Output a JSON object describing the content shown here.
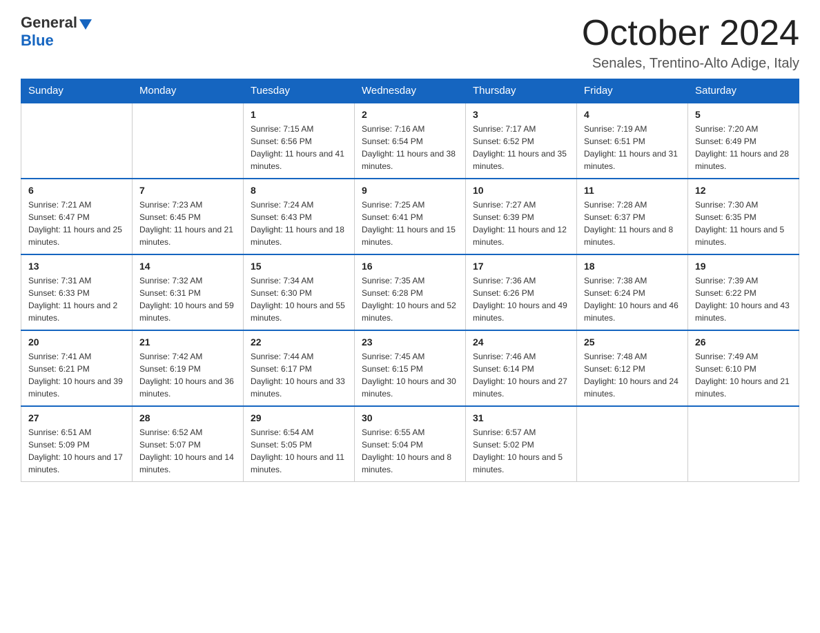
{
  "logo": {
    "general": "General",
    "blue": "Blue"
  },
  "header": {
    "month_year": "October 2024",
    "location": "Senales, Trentino-Alto Adige, Italy"
  },
  "weekdays": [
    "Sunday",
    "Monday",
    "Tuesday",
    "Wednesday",
    "Thursday",
    "Friday",
    "Saturday"
  ],
  "weeks": [
    [
      {
        "day": "",
        "sunrise": "",
        "sunset": "",
        "daylight": ""
      },
      {
        "day": "",
        "sunrise": "",
        "sunset": "",
        "daylight": ""
      },
      {
        "day": "1",
        "sunrise": "Sunrise: 7:15 AM",
        "sunset": "Sunset: 6:56 PM",
        "daylight": "Daylight: 11 hours and 41 minutes."
      },
      {
        "day": "2",
        "sunrise": "Sunrise: 7:16 AM",
        "sunset": "Sunset: 6:54 PM",
        "daylight": "Daylight: 11 hours and 38 minutes."
      },
      {
        "day": "3",
        "sunrise": "Sunrise: 7:17 AM",
        "sunset": "Sunset: 6:52 PM",
        "daylight": "Daylight: 11 hours and 35 minutes."
      },
      {
        "day": "4",
        "sunrise": "Sunrise: 7:19 AM",
        "sunset": "Sunset: 6:51 PM",
        "daylight": "Daylight: 11 hours and 31 minutes."
      },
      {
        "day": "5",
        "sunrise": "Sunrise: 7:20 AM",
        "sunset": "Sunset: 6:49 PM",
        "daylight": "Daylight: 11 hours and 28 minutes."
      }
    ],
    [
      {
        "day": "6",
        "sunrise": "Sunrise: 7:21 AM",
        "sunset": "Sunset: 6:47 PM",
        "daylight": "Daylight: 11 hours and 25 minutes."
      },
      {
        "day": "7",
        "sunrise": "Sunrise: 7:23 AM",
        "sunset": "Sunset: 6:45 PM",
        "daylight": "Daylight: 11 hours and 21 minutes."
      },
      {
        "day": "8",
        "sunrise": "Sunrise: 7:24 AM",
        "sunset": "Sunset: 6:43 PM",
        "daylight": "Daylight: 11 hours and 18 minutes."
      },
      {
        "day": "9",
        "sunrise": "Sunrise: 7:25 AM",
        "sunset": "Sunset: 6:41 PM",
        "daylight": "Daylight: 11 hours and 15 minutes."
      },
      {
        "day": "10",
        "sunrise": "Sunrise: 7:27 AM",
        "sunset": "Sunset: 6:39 PM",
        "daylight": "Daylight: 11 hours and 12 minutes."
      },
      {
        "day": "11",
        "sunrise": "Sunrise: 7:28 AM",
        "sunset": "Sunset: 6:37 PM",
        "daylight": "Daylight: 11 hours and 8 minutes."
      },
      {
        "day": "12",
        "sunrise": "Sunrise: 7:30 AM",
        "sunset": "Sunset: 6:35 PM",
        "daylight": "Daylight: 11 hours and 5 minutes."
      }
    ],
    [
      {
        "day": "13",
        "sunrise": "Sunrise: 7:31 AM",
        "sunset": "Sunset: 6:33 PM",
        "daylight": "Daylight: 11 hours and 2 minutes."
      },
      {
        "day": "14",
        "sunrise": "Sunrise: 7:32 AM",
        "sunset": "Sunset: 6:31 PM",
        "daylight": "Daylight: 10 hours and 59 minutes."
      },
      {
        "day": "15",
        "sunrise": "Sunrise: 7:34 AM",
        "sunset": "Sunset: 6:30 PM",
        "daylight": "Daylight: 10 hours and 55 minutes."
      },
      {
        "day": "16",
        "sunrise": "Sunrise: 7:35 AM",
        "sunset": "Sunset: 6:28 PM",
        "daylight": "Daylight: 10 hours and 52 minutes."
      },
      {
        "day": "17",
        "sunrise": "Sunrise: 7:36 AM",
        "sunset": "Sunset: 6:26 PM",
        "daylight": "Daylight: 10 hours and 49 minutes."
      },
      {
        "day": "18",
        "sunrise": "Sunrise: 7:38 AM",
        "sunset": "Sunset: 6:24 PM",
        "daylight": "Daylight: 10 hours and 46 minutes."
      },
      {
        "day": "19",
        "sunrise": "Sunrise: 7:39 AM",
        "sunset": "Sunset: 6:22 PM",
        "daylight": "Daylight: 10 hours and 43 minutes."
      }
    ],
    [
      {
        "day": "20",
        "sunrise": "Sunrise: 7:41 AM",
        "sunset": "Sunset: 6:21 PM",
        "daylight": "Daylight: 10 hours and 39 minutes."
      },
      {
        "day": "21",
        "sunrise": "Sunrise: 7:42 AM",
        "sunset": "Sunset: 6:19 PM",
        "daylight": "Daylight: 10 hours and 36 minutes."
      },
      {
        "day": "22",
        "sunrise": "Sunrise: 7:44 AM",
        "sunset": "Sunset: 6:17 PM",
        "daylight": "Daylight: 10 hours and 33 minutes."
      },
      {
        "day": "23",
        "sunrise": "Sunrise: 7:45 AM",
        "sunset": "Sunset: 6:15 PM",
        "daylight": "Daylight: 10 hours and 30 minutes."
      },
      {
        "day": "24",
        "sunrise": "Sunrise: 7:46 AM",
        "sunset": "Sunset: 6:14 PM",
        "daylight": "Daylight: 10 hours and 27 minutes."
      },
      {
        "day": "25",
        "sunrise": "Sunrise: 7:48 AM",
        "sunset": "Sunset: 6:12 PM",
        "daylight": "Daylight: 10 hours and 24 minutes."
      },
      {
        "day": "26",
        "sunrise": "Sunrise: 7:49 AM",
        "sunset": "Sunset: 6:10 PM",
        "daylight": "Daylight: 10 hours and 21 minutes."
      }
    ],
    [
      {
        "day": "27",
        "sunrise": "Sunrise: 6:51 AM",
        "sunset": "Sunset: 5:09 PM",
        "daylight": "Daylight: 10 hours and 17 minutes."
      },
      {
        "day": "28",
        "sunrise": "Sunrise: 6:52 AM",
        "sunset": "Sunset: 5:07 PM",
        "daylight": "Daylight: 10 hours and 14 minutes."
      },
      {
        "day": "29",
        "sunrise": "Sunrise: 6:54 AM",
        "sunset": "Sunset: 5:05 PM",
        "daylight": "Daylight: 10 hours and 11 minutes."
      },
      {
        "day": "30",
        "sunrise": "Sunrise: 6:55 AM",
        "sunset": "Sunset: 5:04 PM",
        "daylight": "Daylight: 10 hours and 8 minutes."
      },
      {
        "day": "31",
        "sunrise": "Sunrise: 6:57 AM",
        "sunset": "Sunset: 5:02 PM",
        "daylight": "Daylight: 10 hours and 5 minutes."
      },
      {
        "day": "",
        "sunrise": "",
        "sunset": "",
        "daylight": ""
      },
      {
        "day": "",
        "sunrise": "",
        "sunset": "",
        "daylight": ""
      }
    ]
  ]
}
